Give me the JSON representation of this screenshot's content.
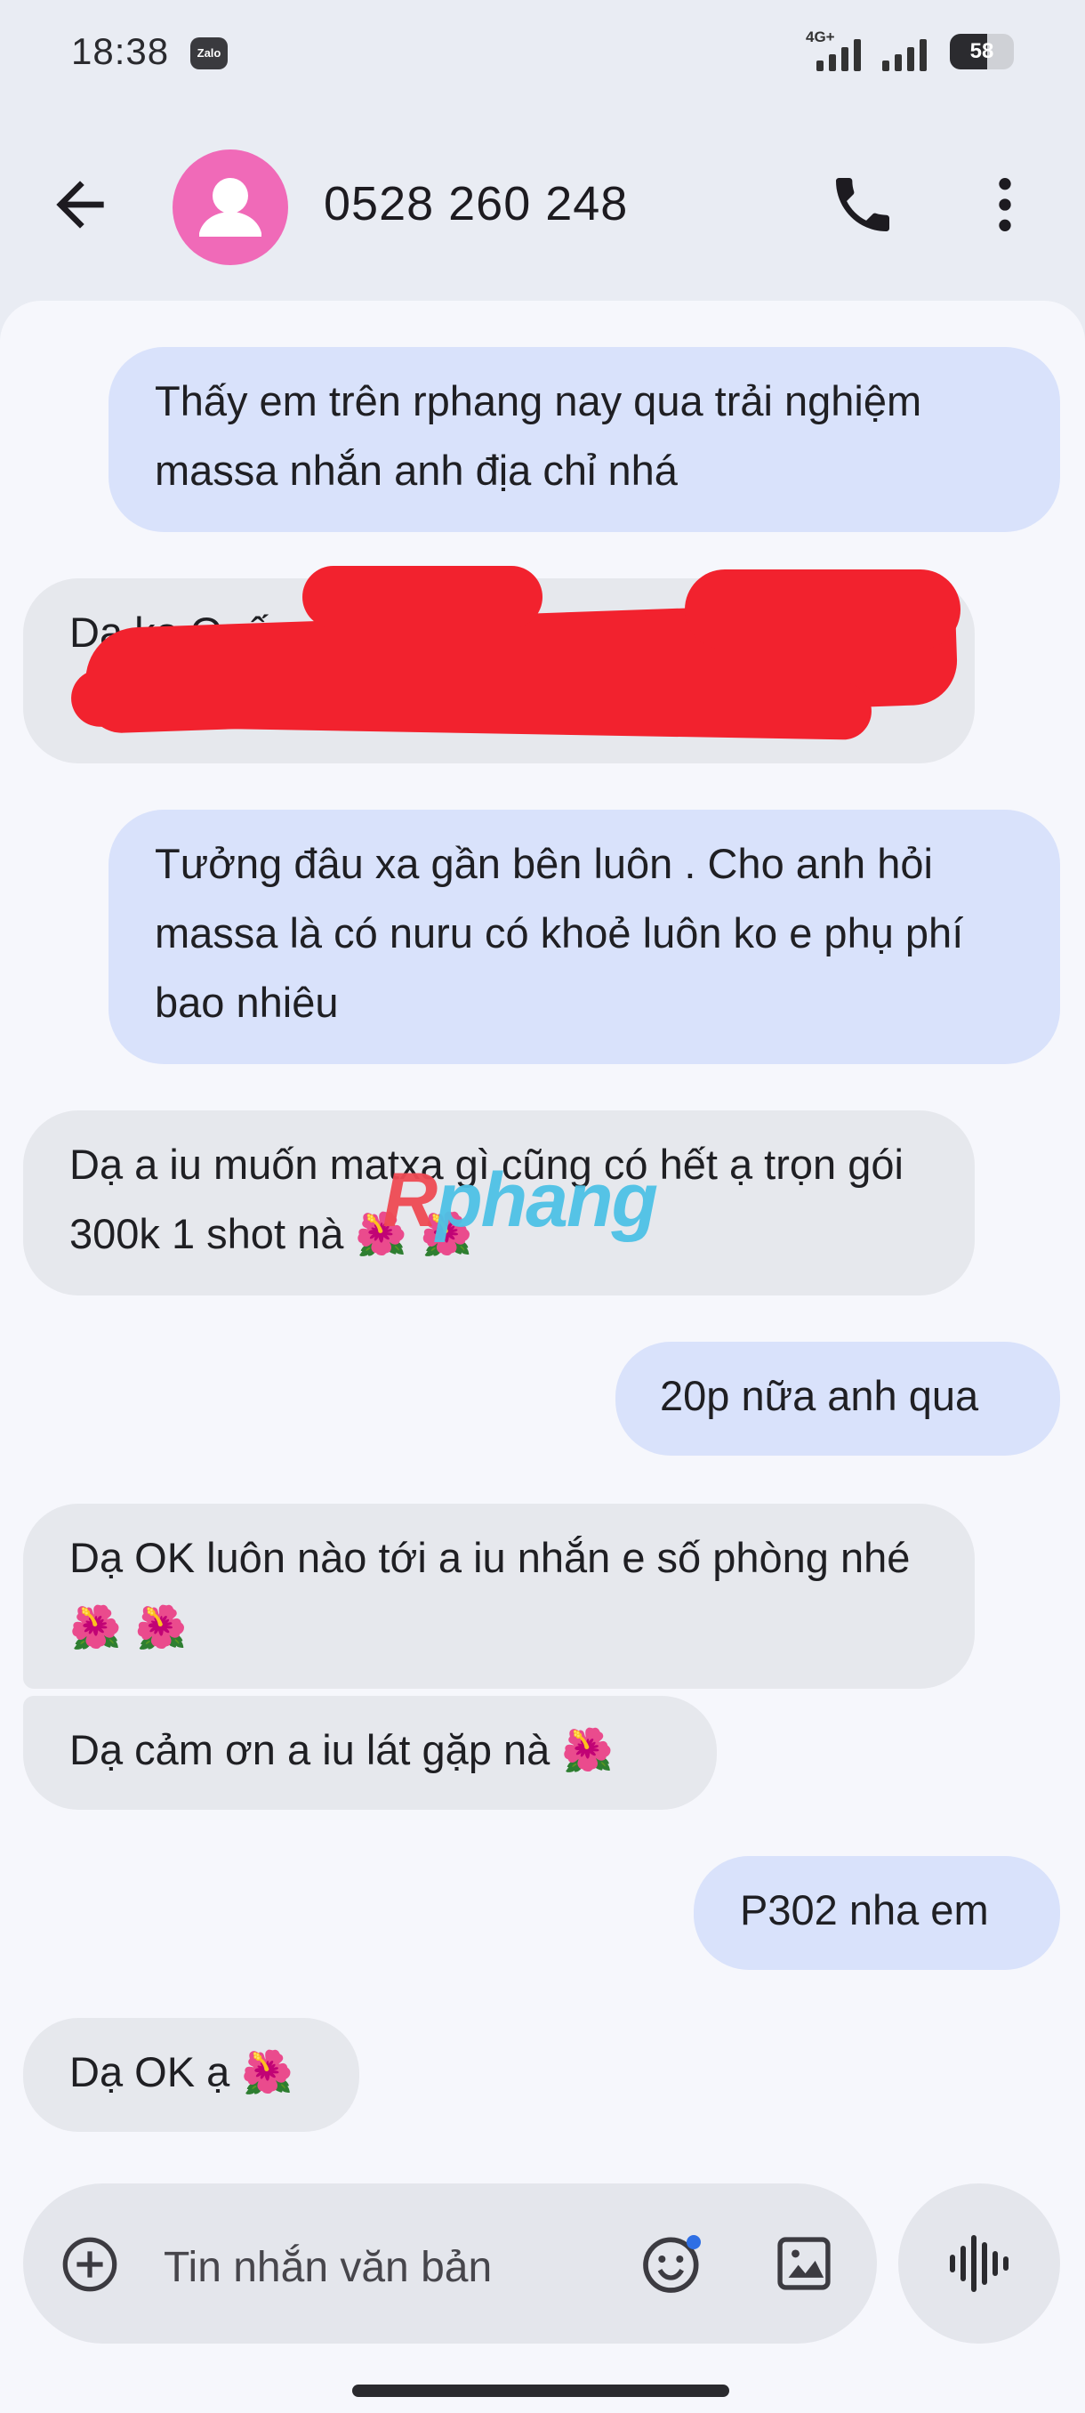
{
  "status_bar": {
    "time": "18:38",
    "notification_app": "Zalo",
    "network": "4G+",
    "battery": "58",
    "battery_level": 0.58
  },
  "header": {
    "title": "0528 260 248",
    "icons": {
      "back": "arrow-left-icon",
      "avatar": "person-icon",
      "call": "phone-icon",
      "menu": "more-vert-icon"
    }
  },
  "messages": [
    {
      "direction": "outgoing",
      "text": "Thấy em trên rphang nay qua trải nghiệm massa nhắn anh địa chỉ nhá"
    },
    {
      "direction": "incoming",
      "text": "Dạ ko Quế",
      "redacted": true
    },
    {
      "direction": "outgoing",
      "text": "Tưởng đâu xa gần bên luôn . Cho anh hỏi massa là có nuru có khoẻ luôn ko e phụ phí bao nhiêu"
    },
    {
      "direction": "incoming",
      "text": "Dạ a iu muốn matxa gì cũng có hết ạ trọn gói 300k 1 shot nà",
      "emoji": "🌺 🌺"
    },
    {
      "direction": "outgoing",
      "text": "20p nữa anh qua"
    },
    {
      "direction": "incoming",
      "text": "Dạ OK luôn nào tới a iu nhắn e số phòng nhé",
      "emoji": "🌺 🌺"
    },
    {
      "direction": "incoming",
      "text": "Dạ cảm ơn a iu lát gặp nà",
      "emoji": "🌺"
    },
    {
      "direction": "outgoing",
      "text": "P302 nha em"
    },
    {
      "direction": "incoming",
      "text": "Dạ OK ạ",
      "emoji": "🌺"
    }
  ],
  "watermark": {
    "first": "R",
    "rest": "phang"
  },
  "composer": {
    "placeholder": "Tin nhắn văn bản",
    "icons": {
      "add": "add-circle-icon",
      "emoji": "emoji-icon",
      "gallery": "image-icon",
      "voice": "voice-wave-icon"
    }
  },
  "colors": {
    "outgoing_bubble": "#d9e2fb",
    "incoming_bubble": "#e6e8ed",
    "avatar": "#f06ab8",
    "redaction": "#f2222e"
  }
}
